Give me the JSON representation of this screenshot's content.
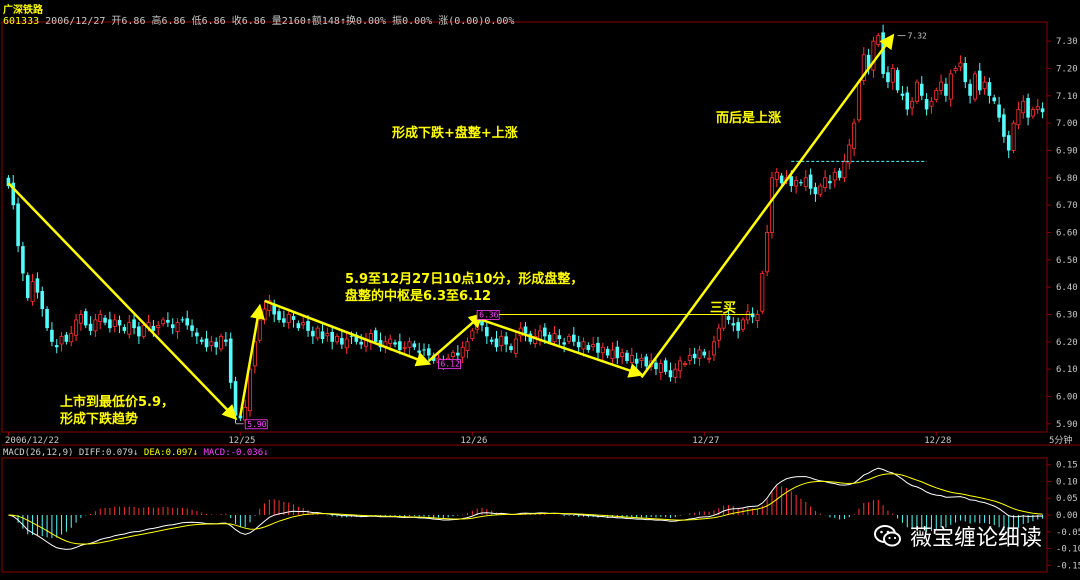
{
  "header": {
    "title": "广深铁路",
    "code": "601333",
    "info": "2006/12/27 开6.86 高6.86 低6.86 收6.86 量2160↑额148↑换0.00% 振0.00% 涨(0.00)0.00%"
  },
  "annotations": {
    "note1_line1": "上市到最低价5.9，",
    "note1_line2": "形成下跌趋势",
    "note2": "形成下跌+盘整+上涨",
    "note3_line1": "5.9至12月27日10点10分，形成盘整，",
    "note3_line2": "盘整的中枢是6.3至6.12",
    "note4": "而后是上涨",
    "note5": "三买"
  },
  "macd": {
    "label": "MACD(26,12,9)",
    "diff": "DIFF:0.079↓",
    "dea": "DEA:0.097↓",
    "macd": "MACD:-0.036↓"
  },
  "watermark": "薇宝缠论细读",
  "colors": {
    "up": "#ff3232",
    "down": "#54fcfc",
    "grid": "#8b0000",
    "accent": "#ffff00",
    "magenta": "#ff40ff"
  },
  "chart_data": {
    "type": "candlestick",
    "period": "5分钟",
    "ylim": [
      5.87,
      7.37
    ],
    "yticks": [
      5.9,
      6.0,
      6.1,
      6.2,
      6.3,
      6.4,
      6.5,
      6.6,
      6.7,
      6.8,
      6.9,
      7.0,
      7.1,
      7.2,
      7.3
    ],
    "xticks": [
      {
        "label": "2006/12/22",
        "bar": 0
      },
      {
        "label": "12/25",
        "bar": 48
      },
      {
        "label": "12/26",
        "bar": 96
      },
      {
        "label": "12/27",
        "bar": 144
      },
      {
        "label": "12/28",
        "bar": 192
      }
    ],
    "close": [
      6.77,
      6.7,
      6.55,
      6.45,
      6.36,
      6.42,
      6.38,
      6.32,
      6.25,
      6.2,
      6.18,
      6.22,
      6.2,
      6.23,
      6.28,
      6.3,
      6.26,
      6.24,
      6.28,
      6.3,
      6.27,
      6.25,
      6.28,
      6.26,
      6.24,
      6.27,
      6.25,
      6.22,
      6.26,
      6.27,
      6.24,
      6.26,
      6.28,
      6.27,
      6.25,
      6.27,
      6.28,
      6.26,
      6.24,
      6.22,
      6.2,
      6.18,
      6.2,
      6.18,
      6.22,
      6.2,
      6.05,
      5.93,
      5.92,
      5.96,
      6.1,
      6.2,
      6.28,
      6.32,
      6.35,
      6.3,
      6.28,
      6.27,
      6.3,
      6.28,
      6.25,
      6.27,
      6.24,
      6.22,
      6.25,
      6.21,
      6.23,
      6.2,
      6.22,
      6.19,
      6.21,
      6.22,
      6.2,
      6.19,
      6.21,
      6.23,
      6.2,
      6.18,
      6.2,
      6.21,
      6.19,
      6.17,
      6.18,
      6.2,
      6.18,
      6.16,
      6.17,
      6.15,
      6.13,
      6.14,
      6.12,
      6.14,
      6.16,
      6.15,
      6.18,
      6.2,
      6.24,
      6.28,
      6.26,
      6.22,
      6.2,
      6.18,
      6.22,
      6.19,
      6.17,
      6.21,
      6.25,
      6.23,
      6.2,
      6.22,
      6.24,
      6.22,
      6.2,
      6.23,
      6.21,
      6.19,
      6.22,
      6.2,
      6.18,
      6.2,
      6.17,
      6.19,
      6.16,
      6.18,
      6.15,
      6.17,
      6.14,
      6.16,
      6.13,
      6.15,
      6.12,
      6.14,
      6.11,
      6.13,
      6.1,
      6.12,
      6.09,
      6.07,
      6.1,
      6.13,
      6.12,
      6.15,
      6.14,
      6.17,
      6.15,
      6.14,
      6.2,
      6.25,
      6.3,
      6.28,
      6.26,
      6.24,
      6.28,
      6.31,
      6.29,
      6.3,
      6.45,
      6.6,
      6.8,
      6.82,
      6.78,
      6.8,
      6.77,
      6.79,
      6.78,
      6.8,
      6.76,
      6.74,
      6.77,
      6.8,
      6.78,
      6.82,
      6.8,
      6.86,
      6.92,
      7.0,
      7.15,
      7.25,
      7.2,
      7.3,
      7.32,
      7.18,
      7.15,
      7.2,
      7.12,
      7.1,
      7.05,
      7.08,
      7.15,
      7.1,
      7.05,
      7.08,
      7.12,
      7.15,
      7.1,
      7.18,
      7.2,
      7.22,
      7.15,
      7.1,
      7.18,
      7.12,
      7.15,
      7.1,
      7.08,
      7.02,
      6.95,
      6.9,
      7.0,
      7.05,
      7.08,
      7.02,
      7.05,
      7.06,
      7.04
    ],
    "levels": [
      {
        "label": "5.90",
        "price": 5.9,
        "bar": 47,
        "box": false
      },
      {
        "label": "5.90",
        "price": 5.9,
        "bar": 49,
        "box": true
      },
      {
        "label": "6.36",
        "price": 6.3,
        "bar": 97,
        "box": true
      },
      {
        "label": "6.12",
        "price": 6.12,
        "bar": 89,
        "box": true
      },
      {
        "label": "7.32",
        "price": 7.32,
        "bar": 184,
        "box": false
      }
    ],
    "lines": [
      {
        "from": [
          0,
          6.78
        ],
        "to": [
          47,
          5.92
        ],
        "arrow": true
      },
      {
        "from": [
          48,
          5.93
        ],
        "to": [
          52,
          6.33
        ],
        "arrow": true
      },
      {
        "from": [
          53,
          6.35
        ],
        "to": [
          87,
          6.12
        ],
        "arrow": true
      },
      {
        "from": [
          87,
          6.13
        ],
        "to": [
          98,
          6.3
        ],
        "arrow": true
      },
      {
        "from": [
          98,
          6.28
        ],
        "to": [
          131,
          6.08
        ],
        "arrow": true
      },
      {
        "from": [
          131,
          6.07
        ],
        "to": [
          183,
          7.32
        ],
        "arrow": true
      }
    ],
    "pivot_line": {
      "price": 6.3,
      "from_bar": 98,
      "to_bar": 154
    },
    "ref_line": {
      "price": 6.86,
      "from_bar": 162,
      "to_bar": 190
    },
    "macd_ylim": [
      -0.17,
      0.17
    ],
    "macd_yticks": [
      -0.15,
      -0.1,
      -0.05,
      0.0,
      0.05,
      0.1,
      0.15
    ]
  }
}
